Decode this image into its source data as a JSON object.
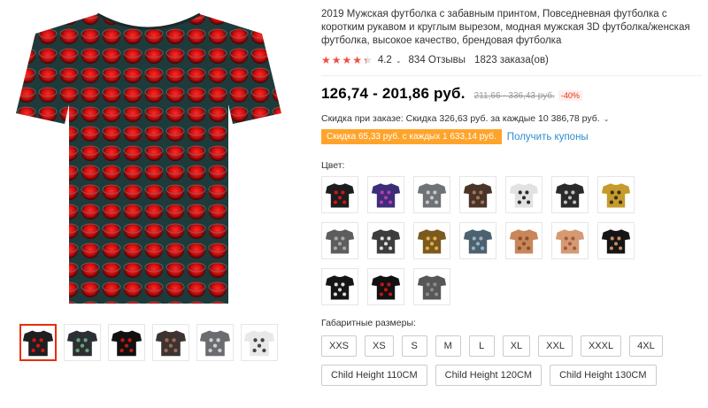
{
  "product": {
    "title": "2019 Мужская футболка с забавным принтом, Повседневная футболка с коротким рукавом и круглым вырезом, модная мужская 3D футболка/женская футболка, высокое качество, брендовая футболка",
    "rating": "4.2",
    "reviews": "834 Отзывы",
    "orders": "1823 заказа(ов)",
    "price_range": "126,74 - 201,86 руб.",
    "old_price": "211,66 - 336,43 руб.",
    "discount_badge": "-40%",
    "order_discount": "Скидка при заказе: Скидка 326,63 руб. за каждые 10 386,78 руб.",
    "coupon_text": "Скидка 65,33 руб. с каждых 1 633,14 руб.",
    "get_coupons": "Получить купоны"
  },
  "color_section": {
    "label": "Цвет:",
    "swatches": [
      {
        "name": "black-red-honeycomb",
        "bg": "#1b1d1e",
        "pattern": "#d21515"
      },
      {
        "name": "purple-galaxy",
        "bg": "#3b2d7a",
        "pattern": "#c03aa8"
      },
      {
        "name": "grey-cube",
        "bg": "#6f7276",
        "pattern": "#c8c8c8"
      },
      {
        "name": "brown-swirl",
        "bg": "#4a3428",
        "pattern": "#a1755c"
      },
      {
        "name": "white-skull",
        "bg": "#e2e2e2",
        "pattern": "#2c2c2c"
      },
      {
        "name": "skeleton-dark",
        "bg": "#2a2a2a",
        "pattern": "#bfbfbf"
      },
      {
        "name": "yellow-mech",
        "bg": "#c49b2c",
        "pattern": "#3a2e1a"
      },
      {
        "name": "grey-robot",
        "bg": "#5d5d5d",
        "pattern": "#a8a8a8"
      },
      {
        "name": "dark-rings",
        "bg": "#3d3d3d",
        "pattern": "#e0e0e0"
      },
      {
        "name": "golden-lion",
        "bg": "#7b5a1f",
        "pattern": "#e3b04b"
      },
      {
        "name": "blue-machine",
        "bg": "#4d6270",
        "pattern": "#9cb2c0"
      },
      {
        "name": "tan-torso",
        "bg": "#c9865a",
        "pattern": "#8a4e2c"
      },
      {
        "name": "skin-muscle",
        "bg": "#d59a74",
        "pattern": "#a05a38"
      },
      {
        "name": "black-suit-torso",
        "bg": "#151515",
        "pattern": "#c88a65"
      },
      {
        "name": "black-skeleton",
        "bg": "#151515",
        "pattern": "#dcdcdc"
      },
      {
        "name": "black-red-dot",
        "bg": "#111",
        "pattern": "#c41515"
      },
      {
        "name": "grey-lines",
        "bg": "#575757",
        "pattern": "#8c8c8c"
      }
    ]
  },
  "size_section": {
    "label": "Габаритные размеры:",
    "sizes": [
      "XXS",
      "XS",
      "S",
      "M",
      "L",
      "XL",
      "XXL",
      "XXXL",
      "4XL",
      "Child Height 110CM",
      "Child Height 120CM",
      "Child Height 130CM"
    ]
  },
  "gallery": {
    "thumbs": [
      {
        "name": "thumb-red-honeycomb",
        "bg": "#1d1f20",
        "pattern": "#d01616"
      },
      {
        "name": "thumb-multicolor-hex",
        "bg": "#2c2f33",
        "pattern": "#6aa27b"
      },
      {
        "name": "thumb-black-red-dot",
        "bg": "#111",
        "pattern": "#c41515"
      },
      {
        "name": "thumb-swirl",
        "bg": "#3d3331",
        "pattern": "#9c6b55"
      },
      {
        "name": "thumb-grey-cube",
        "bg": "#6a6c70",
        "pattern": "#cfcfcf"
      },
      {
        "name": "thumb-collage",
        "bg": "#e8e8e8",
        "pattern": "#444"
      }
    ]
  },
  "colors": {
    "accent_red": "#e62e04",
    "star": "#f04f43",
    "coupon_bg": "#ffa42b",
    "link_blue": "#2f8ccf"
  }
}
